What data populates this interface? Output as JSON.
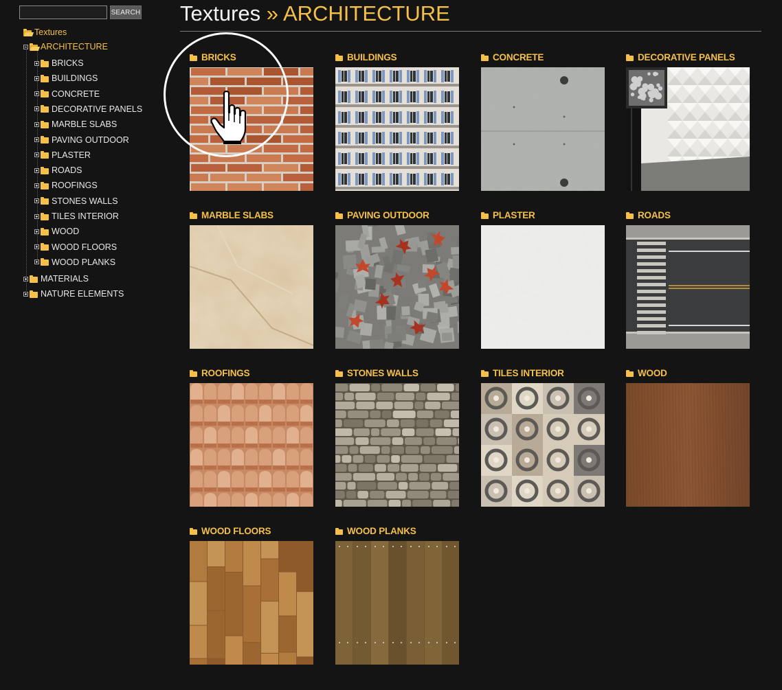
{
  "search": {
    "placeholder": "",
    "value": "",
    "button_label": "SEARCH"
  },
  "tree": {
    "root": "Textures",
    "current": "ARCHITECTURE",
    "children": [
      "BRICKS",
      "BUILDINGS",
      "CONCRETE",
      "DECORATIVE PANELS",
      "MARBLE SLABS",
      "PAVING OUTDOOR",
      "PLASTER",
      "ROADS",
      "ROOFINGS",
      "STONES WALLS",
      "TILES INTERIOR",
      "WOOD",
      "WOOD FLOORS",
      "WOOD PLANKS"
    ],
    "siblings": [
      "MATERIALS",
      "NATURE ELEMENTS"
    ]
  },
  "header": {
    "title": "Textures",
    "separator": "»",
    "subtitle": "ARCHITECTURE"
  },
  "categories": [
    {
      "label": "BRICKS",
      "icon": "folder-icon",
      "thumb": "bricks"
    },
    {
      "label": "BUILDINGS",
      "icon": "folder-icon",
      "thumb": "buildings"
    },
    {
      "label": "CONCRETE",
      "icon": "folder-icon",
      "thumb": "concrete"
    },
    {
      "label": "DECORATIVE PANELS",
      "icon": "folder-icon",
      "thumb": "panels"
    },
    {
      "label": "MARBLE SLABS",
      "icon": "folder-icon",
      "thumb": "marble"
    },
    {
      "label": "PAVING OUTDOOR",
      "icon": "folder-icon",
      "thumb": "paving"
    },
    {
      "label": "PLASTER",
      "icon": "folder-icon",
      "thumb": "plaster"
    },
    {
      "label": "ROADS",
      "icon": "folder-icon",
      "thumb": "roads"
    },
    {
      "label": "ROOFINGS",
      "icon": "folder-icon",
      "thumb": "roofings"
    },
    {
      "label": "STONES WALLS",
      "icon": "folder-icon",
      "thumb": "stones"
    },
    {
      "label": "TILES INTERIOR",
      "icon": "folder-icon",
      "thumb": "tiles"
    },
    {
      "label": "WOOD",
      "icon": "folder-icon",
      "thumb": "wood"
    },
    {
      "label": "WOOD FLOORS",
      "icon": "folder-icon",
      "thumb": "woodfloors"
    },
    {
      "label": "WOOD PLANKS",
      "icon": "folder-icon",
      "thumb": "woodplanks"
    }
  ],
  "colors": {
    "accent": "#f5c04a",
    "background": "#141414",
    "text": "#e6e6e6"
  },
  "cursor": {
    "icon": "hand-pointer-icon"
  }
}
